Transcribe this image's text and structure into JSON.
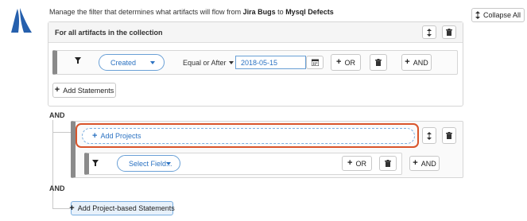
{
  "header": {
    "description_prefix": "Manage the filter that determines what artifacts will flow from",
    "source": "Jira Bugs",
    "connector": "to",
    "target": "Mysql Defects"
  },
  "collapse_all_label": "Collapse All",
  "collection_panel": {
    "title": "For all artifacts in the collection",
    "statement": {
      "field": "Created",
      "operator": "Equal or After",
      "value": "2018-05-15",
      "or_label": "OR",
      "and_label": "AND"
    },
    "add_statements_label": "Add Statements"
  },
  "and_label_1": "AND",
  "project_panel": {
    "add_projects_label": "Add Projects",
    "statement": {
      "field_placeholder": "Select Field...",
      "or_label": "OR",
      "and_label": "AND"
    }
  },
  "and_label_2": "AND",
  "add_project_statements_label": "Add Project-based Statements",
  "colors": {
    "accent_blue": "#2b72c2",
    "highlight_orange": "#d9552b",
    "logo_blue": "#2660ad"
  }
}
